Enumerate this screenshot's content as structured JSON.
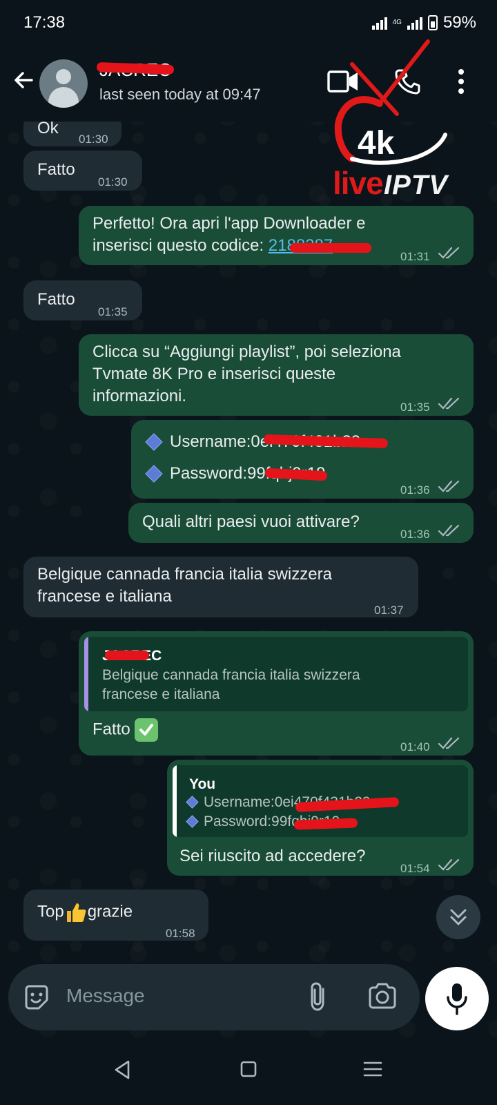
{
  "status_bar": {
    "time": "17:38",
    "network": "4G",
    "battery": "59%"
  },
  "header": {
    "contact_name": "JACREC",
    "last_seen": "last seen today at 09:47",
    "icons": [
      "back-arrow-icon",
      "video-call-icon",
      "voice-call-icon",
      "more-options-icon"
    ]
  },
  "overlay_logo": {
    "line1": "4k",
    "live": "live",
    "iptv": "IPTV"
  },
  "messages": [
    {
      "dir": "in",
      "text": "Ok",
      "time": "01:30"
    },
    {
      "dir": "in",
      "text": "Fatto",
      "time": "01:30"
    },
    {
      "dir": "out",
      "line1": "Perfetto! Ora apri l'app Downloader e",
      "line2": "inserisci questo codice: ",
      "link": "2188387",
      "time": "01:31"
    },
    {
      "dir": "in",
      "text": "Fatto",
      "time": "01:35"
    },
    {
      "dir": "out",
      "line1": "Clicca su “Aggiungi playlist”, poi seleziona",
      "line2": "Tvmate 8K Pro e inserisci queste",
      "line3": "informazioni.",
      "time": "01:35"
    },
    {
      "dir": "out",
      "username": "Username:0ei470f431b29",
      "password": "Password:99fqbj9r19",
      "time": "01:36"
    },
    {
      "dir": "out",
      "text": "Quali altri paesi vuoi attivare?",
      "time": "01:36"
    },
    {
      "dir": "in",
      "line1": "Belgique cannada francia italia swizzera",
      "line2": "francese e italiana",
      "time": "01:37"
    },
    {
      "dir": "out",
      "quote_name": "JACREC",
      "quote_line1": "Belgique cannada francia italia swizzera",
      "quote_line2": "francese e italiana",
      "text": "Fatto",
      "time": "01:40"
    },
    {
      "dir": "out",
      "quote_name": "You",
      "quote_line1": "Username:0ei470f431b29",
      "quote_line2": "Password:99fqbj9r19",
      "text": "Sei riuscito ad accedere?",
      "time": "01:54"
    },
    {
      "dir": "in",
      "text_before": "Top",
      "text_after": "grazie",
      "time": "01:58"
    }
  ],
  "composer": {
    "placeholder": "Message"
  },
  "colors": {
    "background": "#0b141a",
    "incoming_bubble": "#202c33",
    "outgoing_bubble": "#1a4d38",
    "link": "#53bdeb",
    "redaction": "#e5141a",
    "quote_bar_contact": "#a791e8",
    "quote_bar_you": "#ffffff"
  }
}
